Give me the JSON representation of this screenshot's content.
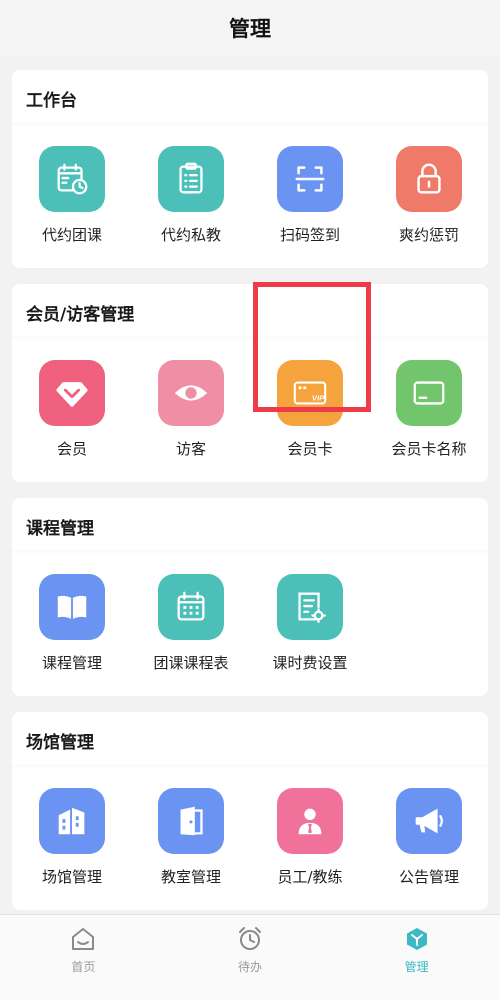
{
  "header": {
    "title": "管理"
  },
  "sections": [
    {
      "title": "工作台",
      "items": [
        {
          "label": "代约团课",
          "icon": "calendar-clock-icon",
          "color": "#4bbfb8"
        },
        {
          "label": "代约私教",
          "icon": "clipboard-list-icon",
          "color": "#4bbfb8"
        },
        {
          "label": "扫码签到",
          "icon": "scan-icon",
          "color": "#6b93f2"
        },
        {
          "label": "爽约惩罚",
          "icon": "lock-icon",
          "color": "#f07a6a"
        }
      ]
    },
    {
      "title": "会员/访客管理",
      "items": [
        {
          "label": "会员",
          "icon": "diamond-heart-icon",
          "color": "#f0617f"
        },
        {
          "label": "访客",
          "icon": "eye-icon",
          "color": "#f08ea3"
        },
        {
          "label": "会员卡",
          "icon": "vip-card-icon",
          "color": "#f5a33d"
        },
        {
          "label": "会员卡名称",
          "icon": "card-icon",
          "color": "#72c46d"
        }
      ]
    },
    {
      "title": "课程管理",
      "items": [
        {
          "label": "课程管理",
          "icon": "book-icon",
          "color": "#6b93f2"
        },
        {
          "label": "团课课程表",
          "icon": "calendar-grid-icon",
          "color": "#4bbfb8"
        },
        {
          "label": "课时费设置",
          "icon": "document-gear-icon",
          "color": "#4bbfb8"
        }
      ]
    },
    {
      "title": "场馆管理",
      "items": [
        {
          "label": "场馆管理",
          "icon": "building-icon",
          "color": "#6b93f2"
        },
        {
          "label": "教室管理",
          "icon": "door-icon",
          "color": "#6b93f2"
        },
        {
          "label": "员工/教练",
          "icon": "staff-icon",
          "color": "#f0719a"
        },
        {
          "label": "公告管理",
          "icon": "megaphone-icon",
          "color": "#6b93f2"
        }
      ]
    }
  ],
  "tabbar": {
    "tabs": [
      {
        "label": "首页",
        "icon": "home-icon",
        "active": false
      },
      {
        "label": "待办",
        "icon": "alarm-clock-icon",
        "active": false
      },
      {
        "label": "管理",
        "icon": "manage-cube-icon",
        "active": true
      }
    ],
    "active_color": "#3cb9c4",
    "inactive_color": "#9a9a9a"
  },
  "highlight": {
    "target": "会员卡",
    "color": "#ee3b49"
  }
}
